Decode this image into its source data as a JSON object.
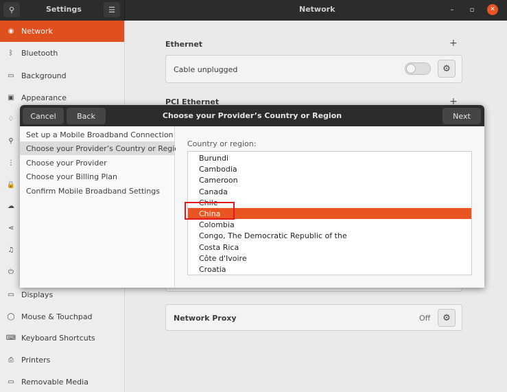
{
  "header": {
    "app_title": "Settings",
    "window_title": "Network",
    "search_glyph": "⚲",
    "menu_glyph": "☰",
    "minimize_glyph": "–",
    "maximize_glyph": "▫",
    "close_glyph": "✕"
  },
  "sidebar": {
    "items": [
      {
        "label": "Network",
        "icon": "network-icon",
        "glyph": "◉",
        "active": true
      },
      {
        "label": "Bluetooth",
        "icon": "bluetooth-icon",
        "glyph": "ᛒ"
      },
      {
        "label": "Background",
        "icon": "background-icon",
        "glyph": "▭"
      },
      {
        "label": "Appearance",
        "icon": "appearance-icon",
        "glyph": "▣"
      },
      {
        "label": "",
        "icon": "notifications-icon",
        "glyph": "♢"
      },
      {
        "label": "",
        "icon": "search-icon",
        "glyph": "⚲"
      },
      {
        "label": "",
        "icon": "applications-icon",
        "glyph": "⋮"
      },
      {
        "label": "",
        "icon": "privacy-icon",
        "glyph": "🔒"
      },
      {
        "label": "",
        "icon": "online-accounts-icon",
        "glyph": "☁"
      },
      {
        "label": "",
        "icon": "sharing-icon",
        "glyph": "⋖"
      },
      {
        "label": "",
        "icon": "sound-icon",
        "glyph": "♫"
      },
      {
        "label": "",
        "icon": "power-icon",
        "glyph": "⏻"
      },
      {
        "label": "Displays",
        "icon": "displays-icon",
        "glyph": "▭"
      },
      {
        "label": "Mouse & Touchpad",
        "icon": "mouse-icon",
        "glyph": "◯"
      },
      {
        "label": "Keyboard Shortcuts",
        "icon": "keyboard-icon",
        "glyph": "⌨"
      },
      {
        "label": "Printers",
        "icon": "printer-icon",
        "glyph": "⎙"
      },
      {
        "label": "Removable Media",
        "icon": "removable-media-icon",
        "glyph": "▭"
      }
    ]
  },
  "main": {
    "ethernet_title": "Ethernet",
    "ethernet_status": "Cable unplugged",
    "pci_title": "PCI Ethernet",
    "proxy_label": "Network Proxy",
    "proxy_status": "Off",
    "plus_glyph": "+",
    "gear_glyph": "⚙"
  },
  "dialog": {
    "cancel_label": "Cancel",
    "back_label": "Back",
    "title": "Choose your Provider’s Country or Region",
    "next_label": "Next",
    "steps": [
      "Set up a Mobile Broadband Connection",
      "Choose your Provider’s Country or Region",
      "Choose your Provider",
      "Choose your Billing Plan",
      "Confirm Mobile Broadband Settings"
    ],
    "current_step": 1,
    "region_label": "Country or region:",
    "countries": [
      "Burundi",
      "Cambodia",
      "Cameroon",
      "Canada",
      "Chile",
      "China",
      "Colombia",
      "Congo, The Democratic Republic of the",
      "Costa Rica",
      "Côte d'Ivoire",
      "Croatia"
    ],
    "selected_country": "China"
  },
  "colors": {
    "accent": "#e95420",
    "header_bg": "#2c2c2c",
    "annotation": "#e0191e"
  }
}
